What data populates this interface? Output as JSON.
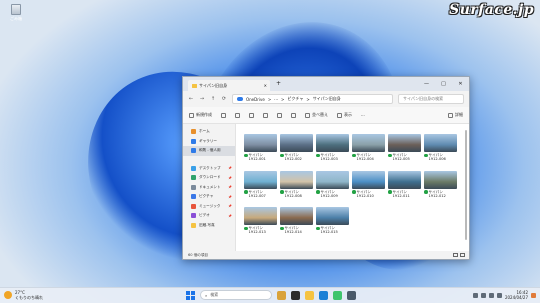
{
  "desktop": {
    "recycle_bin_label": "ごみ箱",
    "brand": "Surface.jp"
  },
  "explorer": {
    "tab_title": "サイパン旧自身",
    "tab_close": "✕",
    "new_tab": "+",
    "window_controls": {
      "minimize": "—",
      "maximize": "□",
      "close": "✕"
    },
    "nav": {
      "back": "←",
      "forward": "→",
      "up": "↑",
      "refresh": "⟳"
    },
    "address": {
      "root": "OneDrive",
      "sep1": ">",
      "more": "···",
      "sep2": ">",
      "crumb1": "ピクチャ",
      "sep3": ">",
      "crumb2": "サイパン旧自身"
    },
    "search_placeholder": "サイパン旧自身の検索",
    "commands": {
      "new": "新規作成",
      "sort": "並べ替え",
      "view": "表示",
      "more": "···",
      "details": "詳細"
    },
    "sidebar_top": [
      {
        "label": "ホーム",
        "color": "#e8902c"
      },
      {
        "label": "ギャラリー",
        "color": "#2f7be8"
      },
      {
        "label": "和則 - 個人用",
        "color": "#2f7be8"
      }
    ],
    "sidebar_pinned": [
      {
        "label": "デスクトップ",
        "color": "#3aa0e8",
        "pin": "📌"
      },
      {
        "label": "ダウンロード",
        "color": "#2fa36b",
        "pin": "📌"
      },
      {
        "label": "ドキュメント",
        "color": "#7b8a9b",
        "pin": "📌"
      },
      {
        "label": "ピクチャ",
        "color": "#3b78e7",
        "pin": "📌"
      },
      {
        "label": "ミュージック",
        "color": "#e8553c",
        "pin": "📌"
      },
      {
        "label": "ビデオ",
        "color": "#8a4fd6",
        "pin": "📌"
      },
      {
        "label": "旧蔵-写真",
        "color": "#f5c342",
        "pin": ""
      }
    ],
    "items": [
      {
        "name": "サイパン",
        "date": "1912-001",
        "color": "#7f8fa3"
      },
      {
        "name": "サイパン",
        "date": "1912-002",
        "color": "#5b6f86"
      },
      {
        "name": "サイパン",
        "date": "1912-003",
        "color": "#4d6f7e"
      },
      {
        "name": "サイパン",
        "date": "1912-004",
        "color": "#8aa0a8"
      },
      {
        "name": "サイパン",
        "date": "1912-005",
        "color": "#6b5f58"
      },
      {
        "name": "サイパン",
        "date": "1912-006",
        "color": "#5f8bb0"
      },
      {
        "name": "サイパン",
        "date": "1912-007",
        "color": "#6fb0d1"
      },
      {
        "name": "サイパン",
        "date": "1912-008",
        "color": "#d2c3a8"
      },
      {
        "name": "サイパン",
        "date": "1912-009",
        "color": "#8fb6c9"
      },
      {
        "name": "サイパン",
        "date": "1912-010",
        "color": "#4c8fc5"
      },
      {
        "name": "サイパン",
        "date": "1912-011",
        "color": "#3e6f8f"
      },
      {
        "name": "サイパン",
        "date": "1912-012",
        "color": "#6a7a66"
      },
      {
        "name": "サイパン",
        "date": "1912-013",
        "color": "#c7a97c"
      },
      {
        "name": "サイパン",
        "date": "1912-014",
        "color": "#8a6a4e"
      },
      {
        "name": "サイパン",
        "date": "1912-015",
        "color": "#4c7fa8"
      }
    ],
    "status": "60 個の項目"
  },
  "taskbar": {
    "weather_temp": "27°C",
    "weather_desc": "くもりのち晴れ",
    "search_placeholder": "検索",
    "clock_time": "16:42",
    "clock_date": "2024/04/27"
  }
}
